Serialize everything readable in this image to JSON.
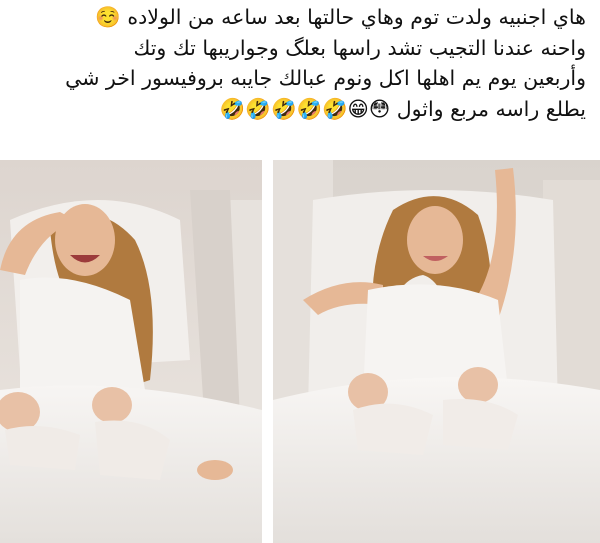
{
  "post": {
    "lines": [
      "هاي اجنبيه ولدت توم وهاي حالتها بعد ساعه من الولاده ☺️",
      "واحنه عندنا التجيب تشد راسها بعلگ وجواريبها تك وتك",
      "وأربعين يوم يم اهلها اكل ونوم عبالك جايبه بروفيسور اخر شي",
      "يطلع راسه مربع واثول 😳😁🤣🤣🤣🤣🤣"
    ]
  },
  "colors": {
    "text": "#111111",
    "background": "#ffffff",
    "wall": "#e9e3de",
    "sheets": "#f4f1ee",
    "skin": "#e6b896",
    "hair": "#b07a3f"
  },
  "images": {
    "left_photo": "mother-laughing-with-twins-in-hospital-bed",
    "right_photo": "mother-raising-arm-with-twins-in-hospital-bed"
  }
}
